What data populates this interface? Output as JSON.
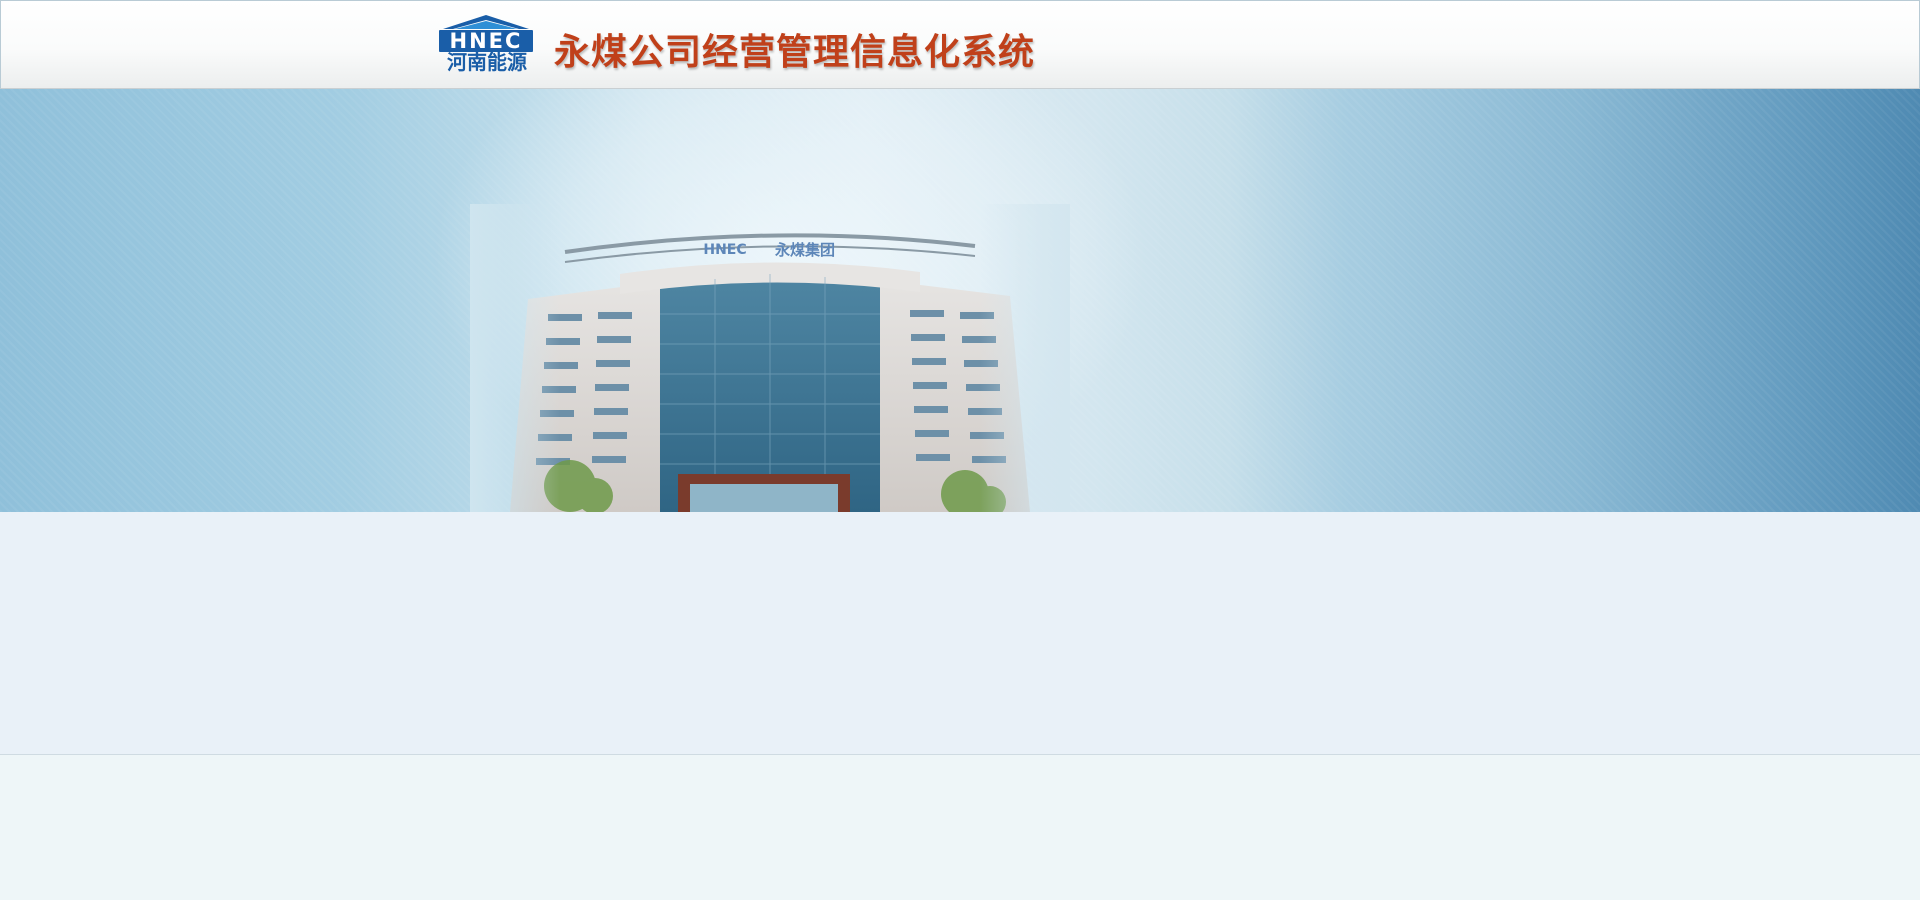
{
  "header": {
    "logo": {
      "abbr": "HNEC",
      "name": "河南能源",
      "icon": "hnec-logo-icon",
      "colors": {
        "blue": "#1a5ea8",
        "light_blue": "#2f8fd6"
      }
    },
    "title": "永煤公司经营管理信息化系统",
    "title_color": "#c0401a"
  },
  "banner": {
    "building_sign": {
      "abbr": "HNEC",
      "name": "永煤集团"
    },
    "colors": {
      "left": "#8fc0da",
      "center": "#dcebf3",
      "right": "#4f8ab2"
    }
  }
}
